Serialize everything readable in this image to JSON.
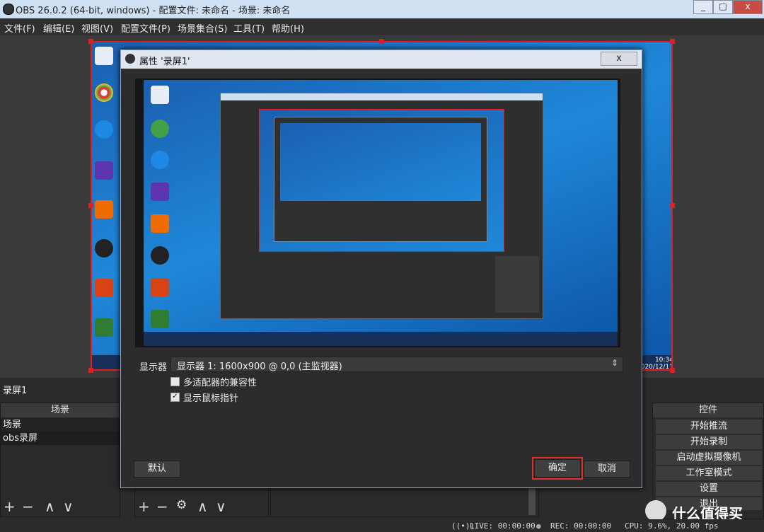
{
  "window": {
    "title": "OBS 26.0.2 (64-bit, windows) - 配置文件: 未命名 - 场景: 未命名"
  },
  "menu": [
    "文件(F)",
    "编辑(E)",
    "视图(V)",
    "配置文件(P)",
    "场景集合(S)",
    "工具(T)",
    "帮助(H)"
  ],
  "source_label": "录屏1",
  "scenes": {
    "header": "场景",
    "items": [
      "场景",
      "obs录屏"
    ]
  },
  "controls": {
    "header": "控件",
    "buttons": [
      "开始推流",
      "开始录制",
      "启动虚拟摄像机",
      "工作室模式",
      "设置",
      "退出"
    ]
  },
  "status": {
    "live": "LIVE: 00:00:00",
    "rec": "REC: 00:00:00",
    "cpu": "CPU: 9.6%, 20.00 fps"
  },
  "desktop_clock": {
    "time": "10:34",
    "date": "2020/12/11"
  },
  "dialog": {
    "title": "属性 '录屏1'",
    "close": "x",
    "display_label": "显示器",
    "display_value": "显示器 1: 1600x900 @ 0,0 (主监视器)",
    "options": [
      {
        "label": "多适配器的兼容性",
        "checked": false
      },
      {
        "label": "显示鼠标指针",
        "checked": true
      }
    ],
    "default_btn": "默认",
    "ok_btn": "确定",
    "cancel_btn": "取消"
  },
  "watermark": "什么值得买"
}
